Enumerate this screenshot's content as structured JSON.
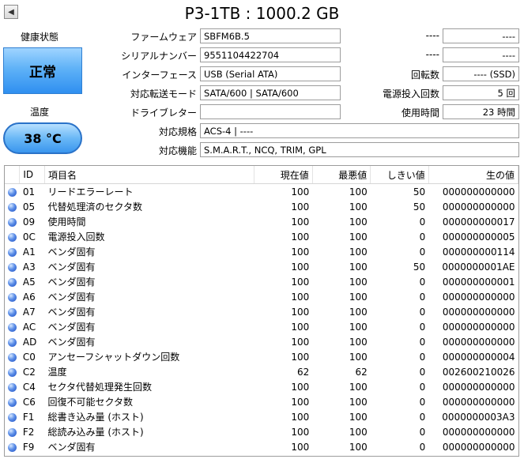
{
  "title": "P3-1TB : 1000.2 GB",
  "health": {
    "label": "健康状態",
    "status": "正常",
    "color": "#4aa8f4"
  },
  "temperature": {
    "label": "温度",
    "value": "38 °C"
  },
  "fields": {
    "firmware": {
      "label": "ファームウェア",
      "value": "SBFM6B.5"
    },
    "serial": {
      "label": "シリアルナンバー",
      "value": "9551104422704"
    },
    "interface": {
      "label": "インターフェース",
      "value": "USB (Serial ATA)"
    },
    "transfer_mode": {
      "label": "対応転送モード",
      "value": "SATA/600 | SATA/600"
    },
    "drive_letter": {
      "label": "ドライブレター",
      "value": ""
    },
    "standard": {
      "label": "対応規格",
      "value": "ACS-4 | ----"
    },
    "features": {
      "label": "対応機能",
      "value": "S.M.A.R.T., NCQ, TRIM, GPL"
    }
  },
  "right_fields": {
    "r1": {
      "label": "----",
      "value": "----"
    },
    "r2": {
      "label": "----",
      "value": "----"
    },
    "rotation": {
      "label": "回転数",
      "value": "---- (SSD)"
    },
    "power_count": {
      "label": "電源投入回数",
      "value": "5 回"
    },
    "power_hours": {
      "label": "使用時間",
      "value": "23 時間"
    }
  },
  "table": {
    "headers": [
      "ID",
      "項目名",
      "現在値",
      "最悪値",
      "しきい値",
      "生の値"
    ],
    "rows": [
      [
        "01",
        "リードエラーレート",
        "100",
        "100",
        "50",
        "000000000000"
      ],
      [
        "05",
        "代替処理済のセクタ数",
        "100",
        "100",
        "50",
        "000000000000"
      ],
      [
        "09",
        "使用時間",
        "100",
        "100",
        "0",
        "000000000017"
      ],
      [
        "0C",
        "電源投入回数",
        "100",
        "100",
        "0",
        "000000000005"
      ],
      [
        "A1",
        "ベンダ固有",
        "100",
        "100",
        "0",
        "000000000114"
      ],
      [
        "A3",
        "ベンダ固有",
        "100",
        "100",
        "50",
        "0000000001AE"
      ],
      [
        "A5",
        "ベンダ固有",
        "100",
        "100",
        "0",
        "000000000001"
      ],
      [
        "A6",
        "ベンダ固有",
        "100",
        "100",
        "0",
        "000000000000"
      ],
      [
        "A7",
        "ベンダ固有",
        "100",
        "100",
        "0",
        "000000000000"
      ],
      [
        "AC",
        "ベンダ固有",
        "100",
        "100",
        "0",
        "000000000000"
      ],
      [
        "AD",
        "ベンダ固有",
        "100",
        "100",
        "0",
        "000000000000"
      ],
      [
        "C0",
        "アンセーフシャットダウン回数",
        "100",
        "100",
        "0",
        "000000000004"
      ],
      [
        "C2",
        "温度",
        "62",
        "62",
        "0",
        "002600210026"
      ],
      [
        "C4",
        "セクタ代替処理発生回数",
        "100",
        "100",
        "0",
        "000000000000"
      ],
      [
        "C6",
        "回復不可能セクタ数",
        "100",
        "100",
        "0",
        "000000000000"
      ],
      [
        "F1",
        "総書き込み量 (ホスト)",
        "100",
        "100",
        "0",
        "0000000003A3"
      ],
      [
        "F2",
        "総読み込み量 (ホスト)",
        "100",
        "100",
        "0",
        "000000000000"
      ],
      [
        "F9",
        "ベンダ固有",
        "100",
        "100",
        "0",
        "000000000000"
      ]
    ]
  }
}
